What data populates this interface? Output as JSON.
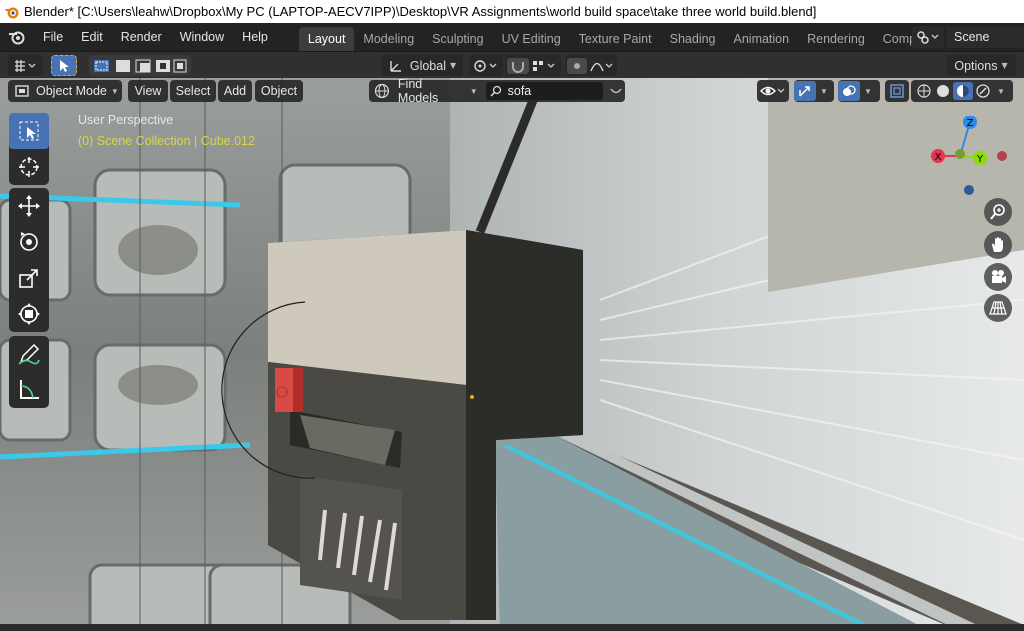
{
  "window": {
    "title": "Blender* [C:\\Users\\leahw\\Dropbox\\My PC (LAPTOP-AECV7IPP)\\Desktop\\VR Assignments\\world build space\\take three world build.blend]"
  },
  "menu": {
    "items": [
      "File",
      "Edit",
      "Render",
      "Window",
      "Help"
    ]
  },
  "workspaces": {
    "tabs": [
      "Layout",
      "Modeling",
      "Sculpting",
      "UV Editing",
      "Texture Paint",
      "Shading",
      "Animation",
      "Rendering",
      "Compos"
    ],
    "active": "Layout"
  },
  "scene": {
    "name": "Scene"
  },
  "tool_header": {
    "transform_orientation": "Global",
    "options_label": "Options"
  },
  "viewport_header": {
    "mode": "Object Mode",
    "view_menu": "View",
    "select_menu": "Select",
    "add_menu": "Add",
    "object_menu": "Object",
    "find_models": "Find Models",
    "search_value": "sofa"
  },
  "viewport_overlay": {
    "perspective": "User Perspective",
    "collection": "(0) Scene Collection | Cube.012"
  },
  "gizmo": {
    "axes": [
      "X",
      "Y",
      "Z"
    ],
    "colors": {
      "x": "#e5364f",
      "y": "#8bdc00",
      "z": "#2e8ae6"
    }
  },
  "colors": {
    "accent": "#4772b3",
    "overlay_yellow": "#d8d840"
  }
}
